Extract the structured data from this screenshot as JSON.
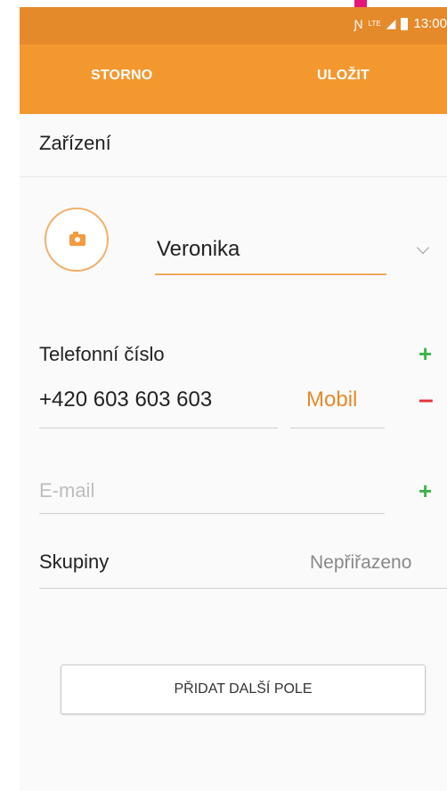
{
  "status_bar": {
    "icons": [
      "nfc-icon",
      "lte-icon",
      "signal-icon",
      "battery-icon"
    ],
    "time": "13:00",
    "lte_label": "LTE"
  },
  "action_bar": {
    "cancel_label": "STORNO",
    "save_label": "ULOŽIT"
  },
  "section": {
    "title": "Zařízení"
  },
  "contact": {
    "name": "Veronika"
  },
  "phone": {
    "label": "Telefonní číslo",
    "number": "+420 603 603 603",
    "type": "Mobil"
  },
  "email": {
    "placeholder": "E-mail"
  },
  "groups": {
    "label": "Skupiny",
    "value": "Nepřiřazeno"
  },
  "add_field": {
    "label": "PŘIDAT DALŠÍ POLE"
  },
  "colors": {
    "accent": "#f3982f",
    "status_bar": "#e58a2a",
    "plus": "#3cb44a",
    "minus": "#e3343a"
  }
}
